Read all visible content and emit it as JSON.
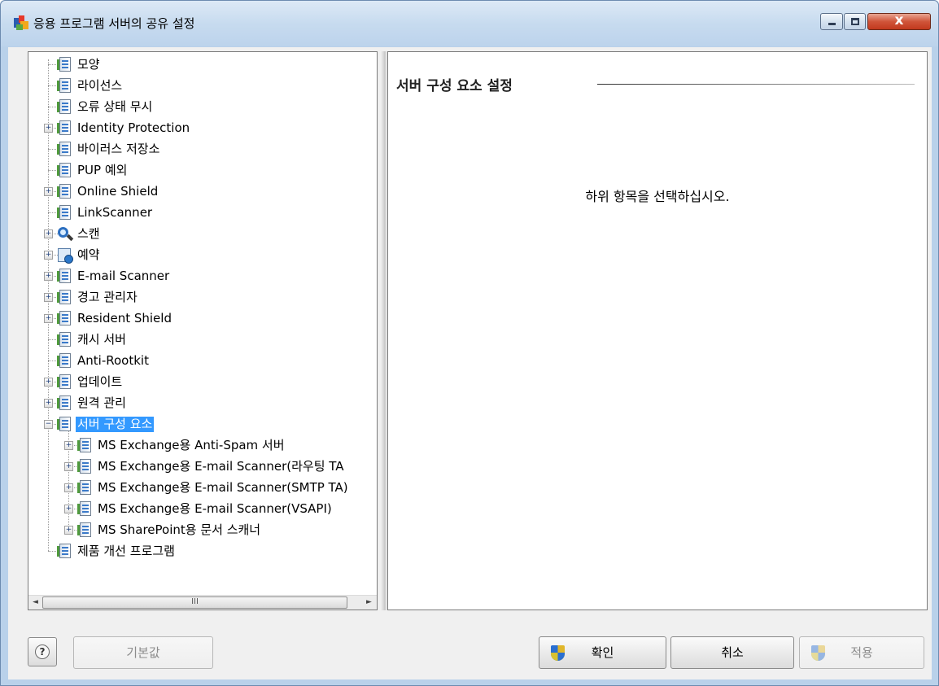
{
  "window": {
    "title": "응용 프로그램 서버의 공유 설정",
    "close_label": "x"
  },
  "tree": {
    "items": [
      {
        "label": "모양",
        "expander": false,
        "icon": "settings-page-icon"
      },
      {
        "label": "라이선스",
        "expander": false,
        "icon": "settings-page-icon"
      },
      {
        "label": "오류 상태 무시",
        "expander": false,
        "icon": "settings-page-icon"
      },
      {
        "label": "Identity Protection",
        "expander": true,
        "icon": "settings-page-icon"
      },
      {
        "label": "바이러스 저장소",
        "expander": false,
        "icon": "settings-page-icon"
      },
      {
        "label": "PUP 예외",
        "expander": false,
        "icon": "settings-page-icon"
      },
      {
        "label": "Online Shield",
        "expander": true,
        "icon": "settings-page-icon"
      },
      {
        "label": "LinkScanner",
        "expander": false,
        "icon": "settings-page-icon"
      },
      {
        "label": "스캔",
        "expander": true,
        "icon": "scan-magnifier-icon"
      },
      {
        "label": "예약",
        "expander": true,
        "icon": "schedule-clock-icon"
      },
      {
        "label": "E-mail Scanner",
        "expander": true,
        "icon": "settings-page-icon"
      },
      {
        "label": "경고 관리자",
        "expander": true,
        "icon": "settings-page-icon"
      },
      {
        "label": "Resident Shield",
        "expander": true,
        "icon": "settings-page-icon"
      },
      {
        "label": "캐시 서버",
        "expander": false,
        "icon": "settings-page-icon"
      },
      {
        "label": "Anti-Rootkit",
        "expander": false,
        "icon": "settings-page-icon"
      },
      {
        "label": "업데이트",
        "expander": true,
        "icon": "settings-page-icon"
      },
      {
        "label": "원격 관리",
        "expander": true,
        "icon": "settings-page-icon"
      },
      {
        "label": "서버 구성 요소",
        "expander": true,
        "expanded": true,
        "selected": true,
        "icon": "settings-page-icon"
      },
      {
        "label": "MS Exchange용 Anti-Spam 서버",
        "expander": true,
        "child": true,
        "icon": "settings-page-icon"
      },
      {
        "label": "MS Exchange용 E-mail Scanner(라우팅 TA",
        "expander": true,
        "child": true,
        "icon": "settings-page-icon"
      },
      {
        "label": "MS Exchange용 E-mail Scanner(SMTP TA)",
        "expander": true,
        "child": true,
        "icon": "settings-page-icon"
      },
      {
        "label": "MS Exchange용 E-mail Scanner(VSAPI)",
        "expander": true,
        "child": true,
        "icon": "settings-page-icon"
      },
      {
        "label": "MS SharePoint용 문서 스캐너",
        "expander": true,
        "child": true,
        "icon": "settings-page-icon"
      },
      {
        "label": "제품 개선 프로그램",
        "expander": false,
        "icon": "settings-page-icon"
      }
    ],
    "scrollbar": {
      "left_arrow": "◄",
      "right_arrow": "►",
      "thumb_grip": "III"
    }
  },
  "content": {
    "section_title": "서버 구성 요소 설정",
    "prompt": "하위 항목을 선택하십시오."
  },
  "buttons": {
    "help": "?",
    "default": "기본값",
    "ok": "확인",
    "cancel": "취소",
    "apply": "적용"
  }
}
